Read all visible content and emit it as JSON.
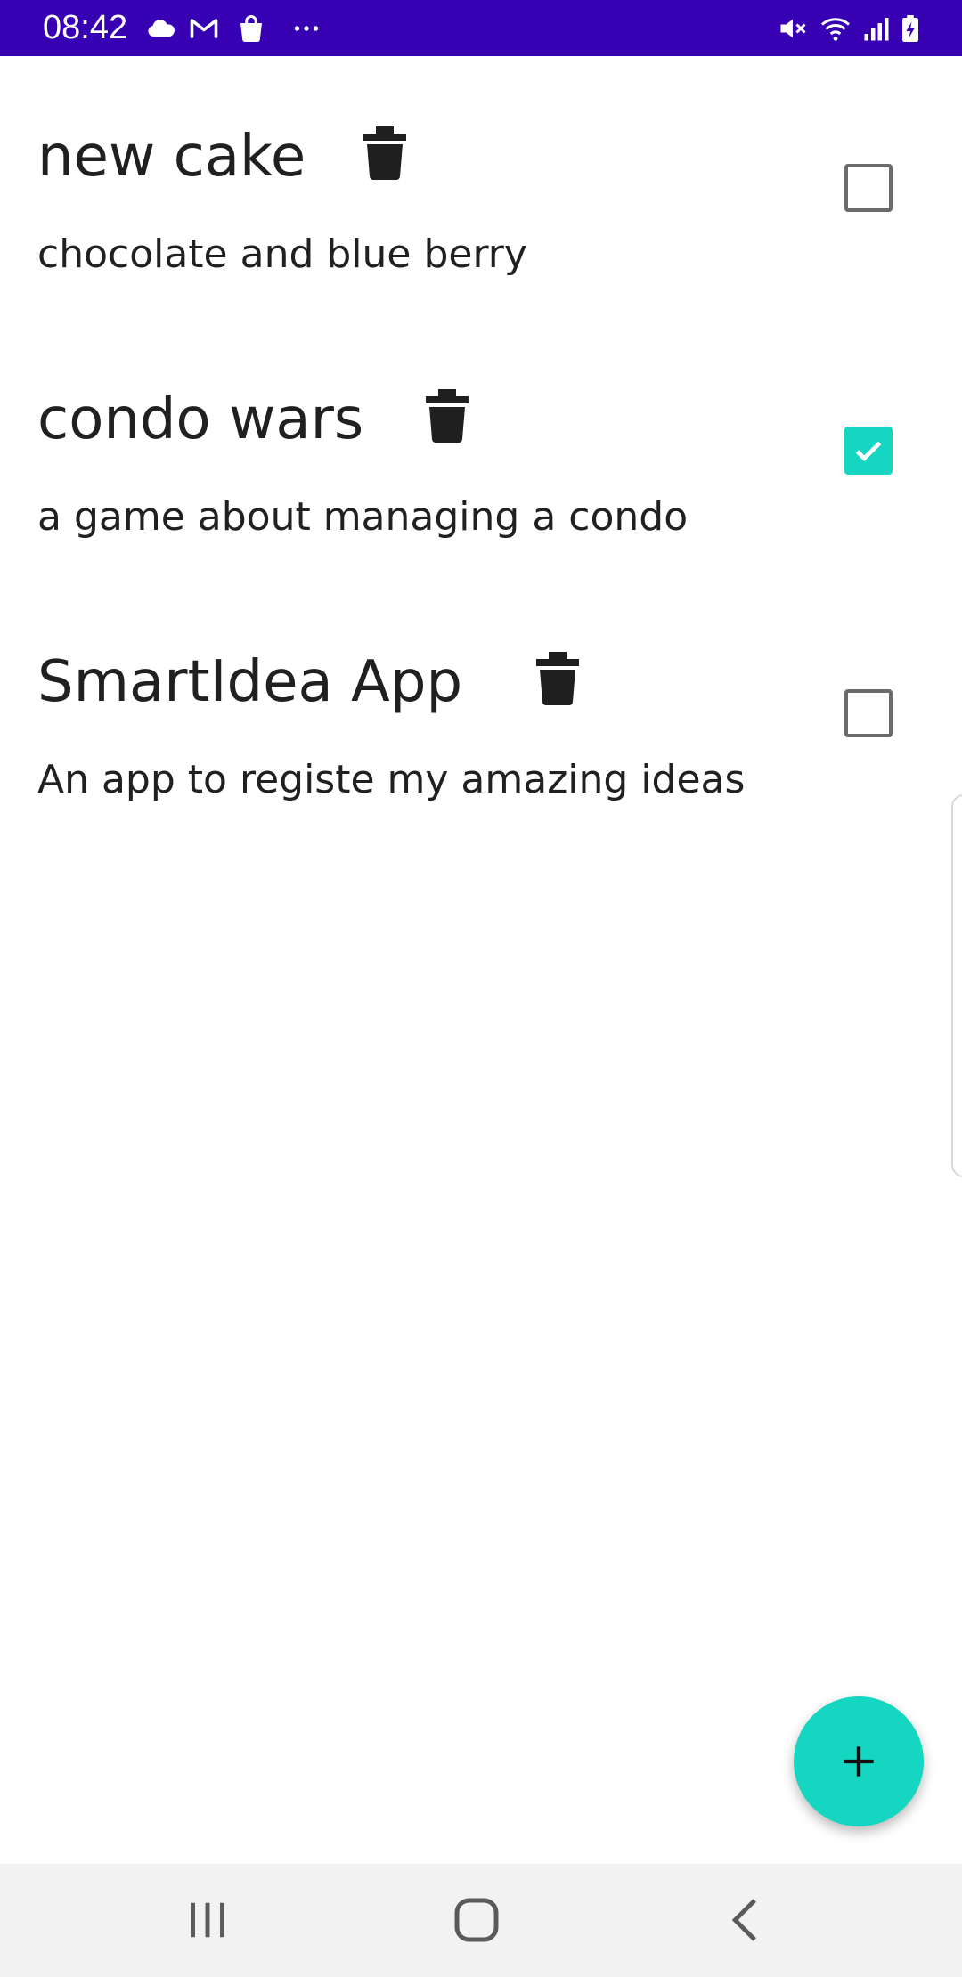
{
  "status_bar": {
    "time": "08:42",
    "left_icons": [
      "cloud-icon",
      "gmail-icon",
      "shopping-bag-icon",
      "more-dots-icon"
    ],
    "right_icons": [
      "mute-icon",
      "wifi-icon",
      "signal-icon",
      "battery-charging-icon"
    ],
    "background": "#3700b3"
  },
  "ideas": [
    {
      "title": "new cake",
      "description": "chocolate and blue berry",
      "done": false
    },
    {
      "title": "condo wars",
      "description": "a game about managing a condo",
      "done": true
    },
    {
      "title": "SmartIdea App",
      "description": "An app to registe my amazing ideas",
      "done": false
    }
  ],
  "colors": {
    "accent": "#15d6c1",
    "text": "#202020",
    "checkbox_border": "#6b6b6b"
  },
  "fab": {
    "icon": "plus-icon"
  },
  "nav_bar": {
    "buttons": [
      "recent-apps-icon",
      "home-icon",
      "back-icon"
    ]
  }
}
